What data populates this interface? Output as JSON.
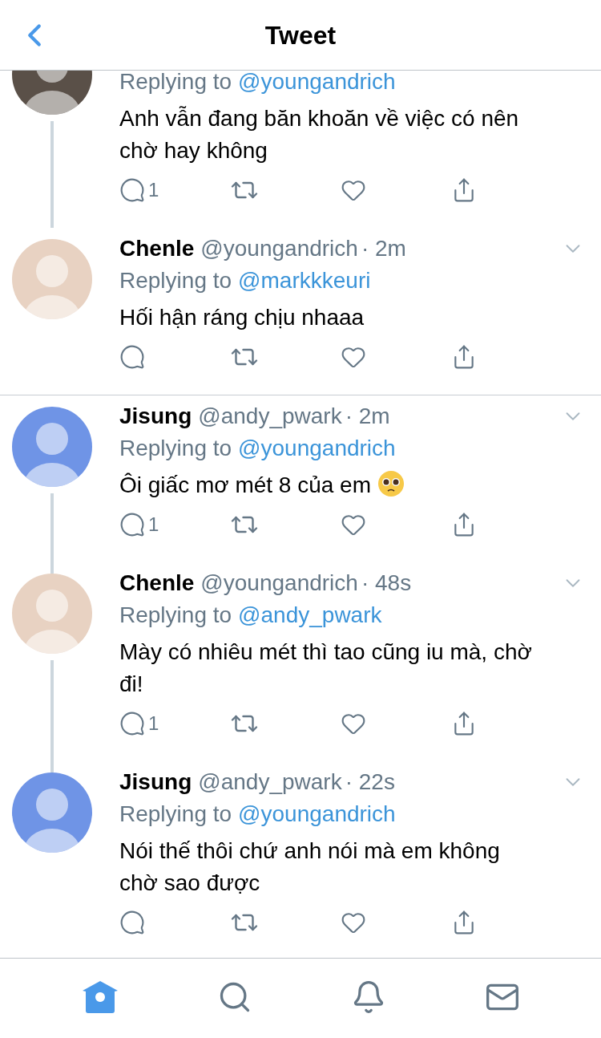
{
  "header": {
    "title": "Tweet"
  },
  "tweets": [
    {
      "partial": true,
      "color": "#5a5048",
      "replying_prefix": "Replying to",
      "replying_handle": "@youngandrich",
      "text": "Anh vẫn đang băn khoăn về việc có nên chờ hay không",
      "reply_count": "1",
      "thread_next": false,
      "separator_after": false
    },
    {
      "partial": false,
      "color": "#e8d2c2",
      "name": "Chenle",
      "handle": "@youngandrich",
      "time": "· 2m",
      "replying_prefix": "Replying to",
      "replying_handle": "@markkkeuri",
      "text": "Hối hận ráng chịu nhaaa",
      "thread_next": false,
      "separator_after": true
    },
    {
      "partial": false,
      "color": "#6f94e6",
      "name": "Jisung",
      "handle": "@andy_pwark",
      "time": "· 2m",
      "replying_prefix": "Replying to",
      "replying_handle": "@youngandrich",
      "text": "Ôi giấc mơ mét 8 của em",
      "emoji": true,
      "reply_count": "1",
      "thread_next": true,
      "separator_after": false
    },
    {
      "partial": false,
      "color": "#e8d2c2",
      "name": "Chenle",
      "handle": "@youngandrich",
      "time": "· 48s",
      "replying_prefix": "Replying to",
      "replying_handle": "@andy_pwark",
      "text": "Mày có nhiêu mét thì tao cũng iu mà, chờ đi!",
      "reply_count": "1",
      "thread_next": true,
      "separator_after": false
    },
    {
      "partial": false,
      "color": "#6f94e6",
      "name": "Jisung",
      "handle": "@andy_pwark",
      "time": "· 22s",
      "replying_prefix": "Replying to",
      "replying_handle": "@youngandrich",
      "text": "Nói thế thôi chứ anh nói mà em không chờ sao được",
      "thread_next": false,
      "separator_after": true
    }
  ],
  "tab_bar": [
    {
      "kind": "home",
      "selected": true
    },
    {
      "kind": "search",
      "selected": false
    },
    {
      "kind": "notifications",
      "selected": false
    },
    {
      "kind": "messages",
      "selected": false
    }
  ]
}
